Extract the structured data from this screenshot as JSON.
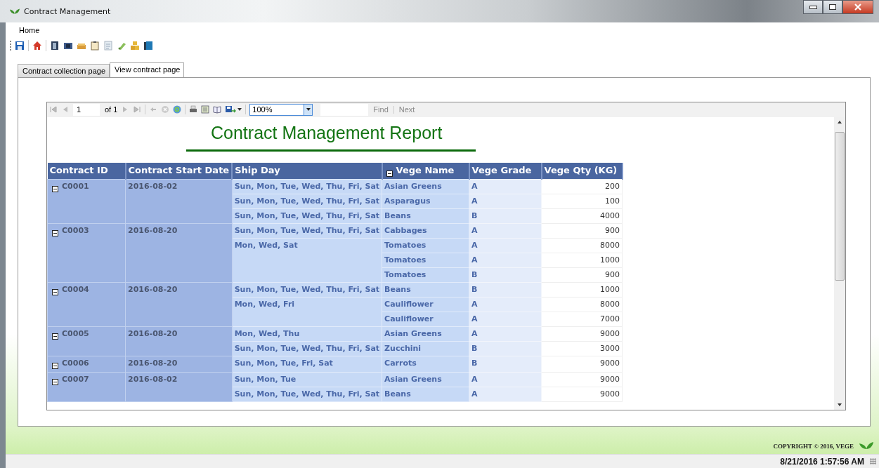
{
  "window": {
    "title": "Contract Management"
  },
  "menu": [
    "Home"
  ],
  "tabs": [
    {
      "label": "Contract collection page",
      "selected": false
    },
    {
      "label": "View contract page",
      "selected": true
    }
  ],
  "report_toolbar": {
    "page": "1",
    "page_count": "of 1",
    "zoom": "100%",
    "find": "Find",
    "next": "Next"
  },
  "report": {
    "title": "Contract Management Report",
    "columns": [
      "Contract ID",
      "Contract Start Date",
      "Ship Day",
      "Vege Name",
      "Vege Grade",
      "Vege Qty (KG)"
    ],
    "vege_group_expanded": true,
    "contracts": [
      {
        "id": "C0001",
        "start_date": "2016-08-02",
        "expanded": true,
        "ship_groups": [
          {
            "ship_day": "Sun, Mon, Tue, Wed, Thu, Fri, Sat",
            "items": [
              {
                "name": "Asian Greens",
                "grade": "A",
                "qty": "200"
              }
            ]
          },
          {
            "ship_day": "Sun, Mon, Tue, Wed, Thu, Fri, Sat",
            "items": [
              {
                "name": "Asparagus",
                "grade": "A",
                "qty": "100"
              }
            ]
          },
          {
            "ship_day": "Sun, Mon, Tue, Wed, Thu, Fri, Sat",
            "items": [
              {
                "name": "Beans",
                "grade": "B",
                "qty": "4000"
              }
            ]
          }
        ]
      },
      {
        "id": "C0003",
        "start_date": "2016-08-20",
        "expanded": true,
        "ship_groups": [
          {
            "ship_day": "Sun, Mon, Tue, Wed, Thu, Fri, Sat",
            "items": [
              {
                "name": "Cabbages",
                "grade": "A",
                "qty": "900"
              }
            ]
          },
          {
            "ship_day": "Mon, Wed, Sat",
            "items": [
              {
                "name": "Tomatoes",
                "grade": "A",
                "qty": "8000"
              },
              {
                "name": "Tomatoes",
                "grade": "A",
                "qty": "1000"
              },
              {
                "name": "Tomatoes",
                "grade": "B",
                "qty": "900"
              }
            ]
          }
        ]
      },
      {
        "id": "C0004",
        "start_date": "2016-08-20",
        "expanded": true,
        "ship_groups": [
          {
            "ship_day": "Sun, Mon, Tue, Wed, Thu, Fri, Sat",
            "items": [
              {
                "name": "Beans",
                "grade": "B",
                "qty": "1000"
              }
            ]
          },
          {
            "ship_day": "Mon, Wed, Fri",
            "items": [
              {
                "name": "Cauliflower",
                "grade": "A",
                "qty": "8000"
              },
              {
                "name": "Cauliflower",
                "grade": "A",
                "qty": "7000"
              }
            ]
          }
        ]
      },
      {
        "id": "C0005",
        "start_date": "2016-08-20",
        "expanded": true,
        "ship_groups": [
          {
            "ship_day": "Mon, Wed, Thu",
            "items": [
              {
                "name": "Asian Greens",
                "grade": "A",
                "qty": "9000"
              }
            ]
          },
          {
            "ship_day": "Sun, Mon, Tue, Wed, Thu, Fri, Sat",
            "items": [
              {
                "name": "Zucchini",
                "grade": "B",
                "qty": "3000"
              }
            ]
          }
        ]
      },
      {
        "id": "C0006",
        "start_date": "2016-08-20",
        "expanded": true,
        "ship_groups": [
          {
            "ship_day": "Sun, Mon, Tue, Fri, Sat",
            "items": [
              {
                "name": "Carrots",
                "grade": "B",
                "qty": "9000"
              }
            ]
          }
        ]
      },
      {
        "id": "C0007",
        "start_date": "2016-08-02",
        "expanded": true,
        "ship_groups": [
          {
            "ship_day": "Sun, Mon, Tue",
            "items": [
              {
                "name": "Asian Greens",
                "grade": "A",
                "qty": "9000"
              }
            ]
          },
          {
            "ship_day": "Sun, Mon, Tue, Wed, Thu, Fri, Sat",
            "items": [
              {
                "name": "Beans",
                "grade": "A",
                "qty": "9000"
              }
            ]
          }
        ]
      }
    ]
  },
  "footer": {
    "copyright": "COPYRIGHT © 2016, VEGE"
  },
  "status_bar": {
    "datetime": "8/21/2016 1:57:56 AM"
  }
}
